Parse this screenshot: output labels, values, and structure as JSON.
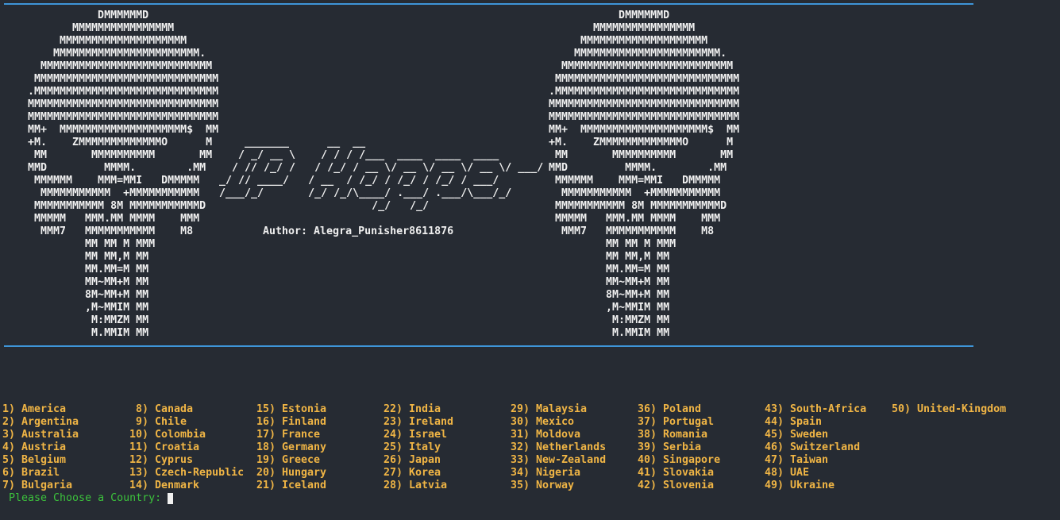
{
  "banner": {
    "left_art": "           DMMMMMMD\n       MMMMMMMMMMMMMMMM\n     MMMMMMMMMMMMMMMMMMMM\n    MMMMMMMMMMMMMMMMMMMMMMM.\n  MMMMMMMMMMMMMMMMMMMMMMMMMMM\n MMMMMMMMMMMMMMMMMMMMMMMMMMMMM\n.MMMMMMMMMMMMMMMMMMMMMMMMMMMMM\nMMMMMMMMMMMMMMMMMMMMMMMMMMMMMM\nMMMMMMMMMMMMMMMMMMMMMMMMMMMMMM\nMM+  MMMMMMMMMMMMMMMMMMMM$  MM\n+M.    ZMMMMMMMMMMMMMO      M\n MM       MMMMMMMMMM       MM\nMMD         MMMM.        .MM\n MMMMMM    MMM=MMI   DMMMMM\n  MMMMMMMMMMM  +MMMMMMMMMMM\n MMMMMMMMMMM 8M MMMMMMMMMMMD\n MMMMM   MMM.MM MMMM    MMM\n  MMM7   MMMMMMMMMMM    M8\n         MM MM M MMM\n         MM MM,M MM\n         MM.MM=M MM\n         MM~MM+M MM\n         8M~MM+M MM\n         ,M~MMIM MM\n          M:MMZM MM\n          M.MMIM MM",
    "right_art": "           DMMMMMMD\n       MMMMMMMMMMMMMMMM\n     MMMMMMMMMMMMMMMMMMMM\n    MMMMMMMMMMMMMMMMMMMMMMM.\n  MMMMMMMMMMMMMMMMMMMMMMMMMMM\n MMMMMMMMMMMMMMMMMMMMMMMMMMMMM\n.MMMMMMMMMMMMMMMMMMMMMMMMMMMMM\nMMMMMMMMMMMMMMMMMMMMMMMMMMMMMM\nMMMMMMMMMMMMMMMMMMMMMMMMMMMMMM\nMM+  MMMMMMMMMMMMMMMMMMMM$  MM\n+M.    ZMMMMMMMMMMMMMO      M\n MM       MMMMMMMMMM       MM\nMMD         MMMM.        .MM\n MMMMMM    MMM=MMI   DMMMMM\n  MMMMMMMMMMM  +MMMMMMMMMMM\n MMMMMMMMMMM 8M MMMMMMMMMMMD\n MMMMM   MMM.MM MMMM    MMM\n  MMM7   MMMMMMMMMMM    M8\n         MM MM M MMM\n         MM MM,M MM\n         MM.MM=M MM\n         MM~MM+M MM\n         8M~MM+M MM\n         ,M~MMIM MM\n          M:MMZM MM\n          M.MMIM MM",
    "title_art": "    _______      __  __\n   / _/ __ \\    / / / /___  ____  ____  ____\n  / // /_/ /   / /_/ / __ \\/ __ \\/ __ \\/ __ \\/ ___/\n_/ // ____/   / __  / /_/ / /_/ / /_/ / ___/\n/___/_/       /_/ /_/\\____/ .___/ .___/\\___/_/\n                        /_/   /_/",
    "author": "Author: Alegra_Punisher8611876"
  },
  "menu": {
    "columns": [
      [
        "1) America",
        "2) Argentina",
        "3) Australia",
        "4) Austria",
        "5) Belgium",
        "6) Brazil",
        "7) Bulgaria"
      ],
      [
        " 8) Canada",
        " 9) Chile",
        "10) Colombia",
        "11) Croatia",
        "12) Cyprus",
        "13) Czech-Republic",
        "14) Denmark"
      ],
      [
        "15) Estonia",
        "16) Finland",
        "17) France",
        "18) Germany",
        "19) Greece",
        "20) Hungary",
        "21) Iceland"
      ],
      [
        "22) India",
        "23) Ireland",
        "24) Israel",
        "25) Italy",
        "26) Japan",
        "27) Korea",
        "28) Latvia"
      ],
      [
        "29) Malaysia",
        "30) Mexico",
        "31) Moldova",
        "32) Netherlands",
        "33) New-Zealand",
        "34) Nigeria",
        "35) Norway"
      ],
      [
        "36) Poland",
        "37) Portugal",
        "38) Romania",
        "39) Serbia",
        "40) Singapore",
        "41) Slovakia",
        "42) Slovenia"
      ],
      [
        "43) South-Africa",
        "44) Spain",
        "45) Sweden",
        "46) Switzerland",
        "47) Taiwan",
        "48) UAE",
        "49) Ukraine"
      ],
      [
        "50) United-Kingdom"
      ]
    ]
  },
  "prompt": {
    "text": "Please Choose a Country:",
    "value": ""
  },
  "colors": {
    "background": "#262b33",
    "rule": "#3e95d8",
    "menu_item": "#f0b545",
    "prompt": "#3cc23c",
    "foreground": "#f0f0f0"
  }
}
